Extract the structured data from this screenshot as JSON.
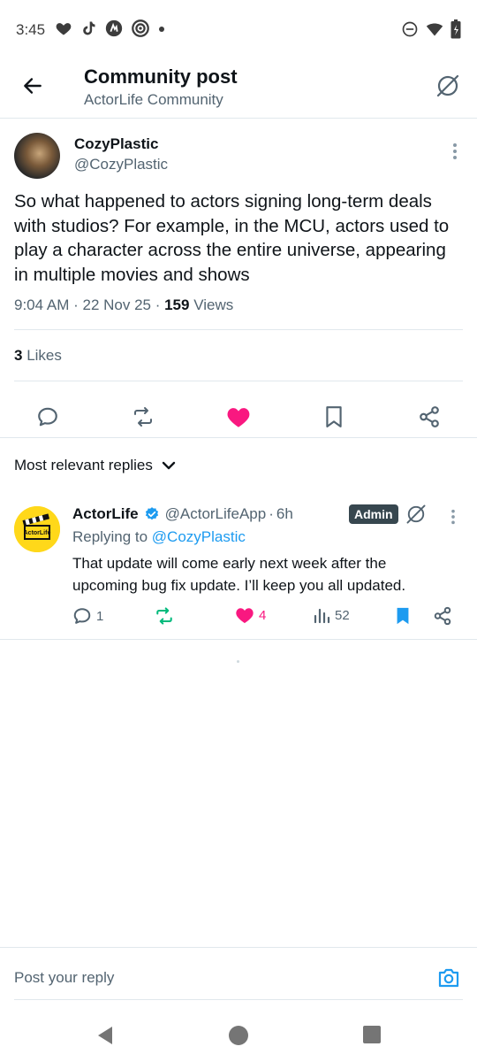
{
  "status_bar": {
    "time": "3:45"
  },
  "header": {
    "title": "Community post",
    "subtitle": "ActorLife Community"
  },
  "post": {
    "author_name": "CozyPlastic",
    "author_handle": "@CozyPlastic",
    "text": "So what happened to actors signing long-term deals with studios? For example, in the MCU, actors used to play a character across the entire universe, appearing in multiple movies and shows",
    "time": "9:04 AM",
    "date": "22 Nov 25",
    "views_count": "159",
    "views_label": "Views",
    "likes_count": "3",
    "likes_label": "Likes"
  },
  "sort": {
    "label": "Most relevant replies"
  },
  "reply": {
    "name": "ActorLife",
    "handle": "@ActorLifeApp",
    "age": "6h",
    "badge": "Admin",
    "replying_to_label": "Replying to",
    "replying_to_handle": "@CozyPlastic",
    "text": "That update will come early next week after the upcoming bug fix update. I’ll keep you all updated.",
    "avatar_text": "ActorLife",
    "replies_count": "1",
    "likes_count": "4",
    "views_count": "52"
  },
  "composer": {
    "placeholder": "Post your reply"
  },
  "colors": {
    "accent_blue": "#1d9bf0",
    "like_pink": "#f91880",
    "retweet_green": "#00ba7c",
    "muted_text": "#536471",
    "badge_bg": "#37474f"
  },
  "icons": {
    "back": "arrow-left-icon",
    "header_action": "hide-slash-icon",
    "comment": "comment-icon",
    "retweet": "retweet-icon",
    "like": "heart-icon",
    "bookmark": "bookmark-icon",
    "share": "share-icon",
    "views": "bar-chart-icon",
    "camera": "camera-icon"
  }
}
